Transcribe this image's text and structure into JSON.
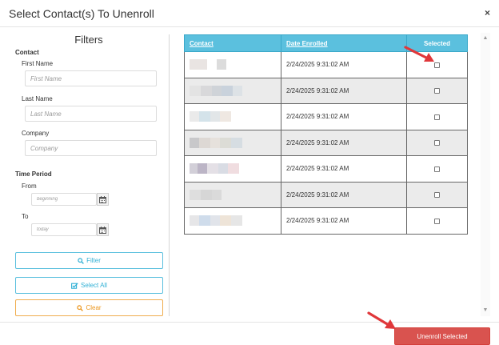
{
  "modal": {
    "title": "Select Contact(s) To Unenroll",
    "close_label": "×"
  },
  "filters": {
    "title": "Filters",
    "contact_section": "Contact",
    "first_name_label": "First Name",
    "first_name_placeholder": "First Name",
    "last_name_label": "Last Name",
    "last_name_placeholder": "Last Name",
    "company_label": "Company",
    "company_placeholder": "Company",
    "time_period_section": "Time Period",
    "from_label": "From",
    "from_placeholder": "beginning",
    "to_label": "To",
    "to_placeholder": "today",
    "filter_button": "Filter",
    "select_all_button": "Select All",
    "clear_button": "Clear"
  },
  "table": {
    "headers": {
      "contact": "Contact",
      "date_enrolled": "Date Enrolled",
      "selected": "Selected"
    },
    "rows": [
      {
        "date_enrolled": "2/24/2025 9:31:02 AM",
        "selected": false
      },
      {
        "date_enrolled": "2/24/2025 9:31:02 AM",
        "selected": false
      },
      {
        "date_enrolled": "2/24/2025 9:31:02 AM",
        "selected": false
      },
      {
        "date_enrolled": "2/24/2025 9:31:02 AM",
        "selected": false
      },
      {
        "date_enrolled": "2/24/2025 9:31:02 AM",
        "selected": false
      },
      {
        "date_enrolled": "2/24/2025 9:31:02 AM",
        "selected": false
      },
      {
        "date_enrolled": "2/24/2025 9:31:02 AM",
        "selected": false
      }
    ]
  },
  "footer": {
    "unenroll_button": "Unenroll Selected"
  },
  "colors": {
    "header_accent": "#5bc0de",
    "info": "#31b0d5",
    "warning": "#ec971f",
    "danger": "#d9534f",
    "annotation_arrow": "#e0373a"
  },
  "icons": {
    "close": "close-icon",
    "calendar": "calendar-icon",
    "search": "search-icon",
    "check_square": "check-square-icon",
    "scroll_up": "chevron-up-icon",
    "scroll_down": "chevron-down-icon",
    "annotation": "red-arrow-icon"
  }
}
